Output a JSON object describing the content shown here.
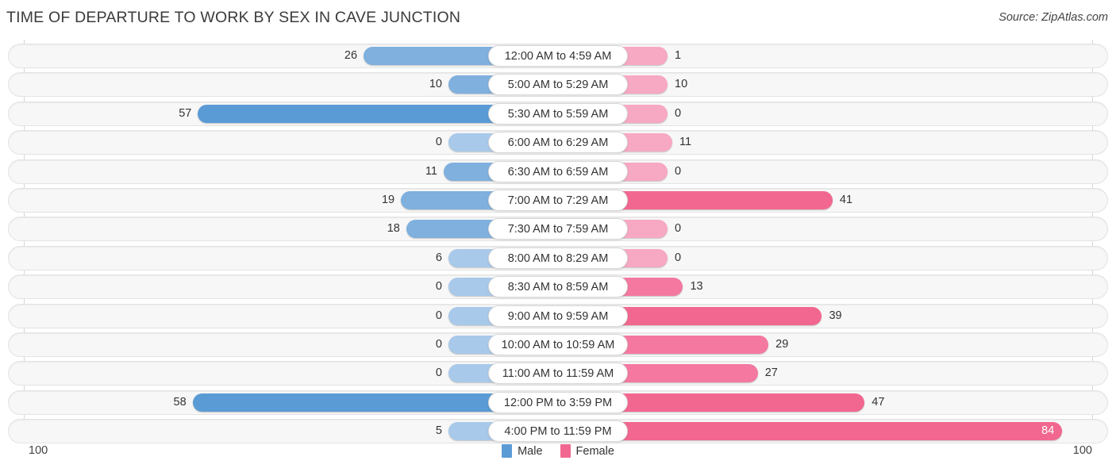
{
  "header": {
    "title": "TIME OF DEPARTURE TO WORK BY SEX IN CAVE JUNCTION",
    "source": "Source: ZipAtlas.com"
  },
  "footer": {
    "axis_left": "100",
    "axis_right": "100",
    "legend": [
      {
        "label": "Male",
        "color": "#5b9bd5"
      },
      {
        "label": "Female",
        "color": "#f2678f"
      }
    ]
  },
  "colors": {
    "male_strong": "#5b9bd5",
    "male_light": "#a8c9ea",
    "female_strong": "#f2678f",
    "female_mid": "#f478a0",
    "female_light": "#f7a8c2",
    "row_bg": "#f7f7f7",
    "row_border": "#e3e3e3",
    "axis_line": "#d5d5d5"
  },
  "chart_data": {
    "type": "bar",
    "title": "TIME OF DEPARTURE TO WORK BY SEX IN CAVE JUNCTION",
    "subtitle": "Source: ZipAtlas.com",
    "orientation": "horizontal-diverging",
    "xlabel": "",
    "ylabel": "",
    "xlim": [
      0,
      100
    ],
    "grid": false,
    "legend_position": "bottom-center",
    "categories": [
      "12:00 AM to 4:59 AM",
      "5:00 AM to 5:29 AM",
      "5:30 AM to 5:59 AM",
      "6:00 AM to 6:29 AM",
      "6:30 AM to 6:59 AM",
      "7:00 AM to 7:29 AM",
      "7:30 AM to 7:59 AM",
      "8:00 AM to 8:29 AM",
      "8:30 AM to 8:59 AM",
      "9:00 AM to 9:59 AM",
      "10:00 AM to 10:59 AM",
      "11:00 AM to 11:59 AM",
      "12:00 PM to 3:59 PM",
      "4:00 PM to 11:59 PM"
    ],
    "series": [
      {
        "name": "Male",
        "color": "#5b9bd5",
        "values": [
          26,
          10,
          57,
          0,
          11,
          19,
          18,
          6,
          0,
          0,
          0,
          0,
          58,
          5
        ]
      },
      {
        "name": "Female",
        "color": "#f2678f",
        "values": [
          1,
          10,
          0,
          11,
          0,
          41,
          0,
          0,
          13,
          39,
          29,
          27,
          47,
          84
        ]
      }
    ]
  }
}
